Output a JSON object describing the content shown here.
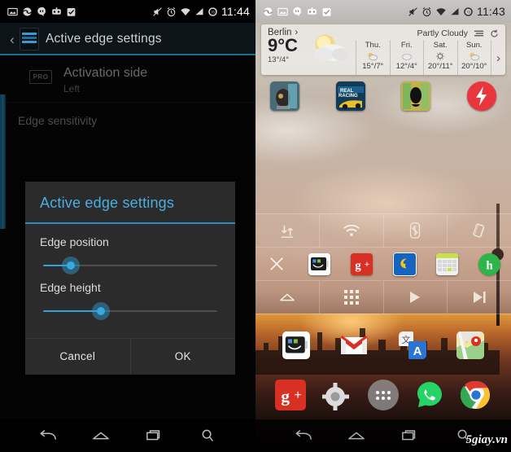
{
  "left_phone": {
    "status_bar": {
      "time": "11:44",
      "left_icons": [
        "screenshot-icon",
        "hangouts-sync-icon",
        "hangouts-icon",
        "app-update-icon",
        "checkbox-app-icon"
      ],
      "right_icons": [
        "mute-icon",
        "alarm-icon",
        "wifi-icon",
        "signal-icon",
        "battery-icon"
      ]
    },
    "action_bar": {
      "back_label": "‹",
      "app_icon": "edge-app-icon",
      "title": "Active edge settings"
    },
    "settings": {
      "pref": {
        "badge": "PRO",
        "title": "Activation side",
        "value": "Left"
      },
      "section_header": "Edge sensitivity"
    },
    "dialog": {
      "title": "Active edge settings",
      "sliders": [
        {
          "label": "Edge position",
          "percent": 17
        },
        {
          "label": "Edge height",
          "percent": 34
        }
      ],
      "cancel_label": "Cancel",
      "ok_label": "OK"
    },
    "nav_bar": {
      "back": "back-icon",
      "home": "home-icon",
      "recents": "recents-icon",
      "search": "search-icon"
    }
  },
  "right_phone": {
    "status_bar": {
      "time": "11:43",
      "left_icons": [
        "hangouts-sync-icon",
        "screenshot-icon",
        "hangouts-icon",
        "app-update-icon",
        "checkbox-app-icon"
      ],
      "right_icons": [
        "mute-icon",
        "alarm-icon",
        "wifi-icon",
        "signal-icon",
        "battery-icon"
      ]
    },
    "weather": {
      "city": "Berlin",
      "city_chevron": "›",
      "temp": "9°C",
      "high_low": "13°/4°",
      "condition": "Partly Cloudy",
      "menu_icon": "list-icon",
      "refresh_icon": "refresh-icon",
      "next_icon": "›",
      "forecast": [
        {
          "day": "Thu.",
          "icon": "partly-cloudy-icon",
          "temps": "15°/7°"
        },
        {
          "day": "Fri.",
          "icon": "cloudy-icon",
          "temps": "12°/4°"
        },
        {
          "day": "Sat.",
          "icon": "sunny-icon",
          "temps": "20°/11°"
        },
        {
          "day": "Sun.",
          "icon": "partly-cloudy-icon",
          "temps": "20°/10°"
        }
      ]
    },
    "top_apps": [
      {
        "name": "shooter-game-icon"
      },
      {
        "name": "real-racing-icon"
      },
      {
        "name": "dungeon-game-icon"
      },
      {
        "name": "boost-icon"
      }
    ],
    "edge_panel": {
      "toggles": [
        {
          "name": "mobile-data-toggle"
        },
        {
          "name": "wifi-toggle"
        },
        {
          "name": "bluetooth-toggle"
        },
        {
          "name": "rotation-toggle"
        }
      ],
      "apps": [
        {
          "name": "close-icon"
        },
        {
          "name": "smiley-tablet-icon"
        },
        {
          "name": "google-plus-icon"
        },
        {
          "name": "swiftkey-icon"
        },
        {
          "name": "calendar-icon"
        },
        {
          "name": "hopper-icon"
        }
      ],
      "controls": [
        {
          "name": "home-icon"
        },
        {
          "name": "app-drawer-icon"
        },
        {
          "name": "play-icon"
        },
        {
          "name": "next-track-icon"
        }
      ]
    },
    "home_apps_row_1": [
      {
        "name": "smiley-tablet-icon"
      },
      {
        "name": "gmail-icon"
      },
      {
        "name": "google-translate-icon"
      },
      {
        "name": "google-maps-icon"
      }
    ],
    "home_apps_row_2": [
      {
        "name": "google-plus-icon"
      },
      {
        "name": "settings-icon"
      },
      {
        "name": "app-drawer-icon"
      },
      {
        "name": "whatsapp-icon"
      },
      {
        "name": "chrome-icon"
      }
    ],
    "nav_bar": {
      "back": "back-icon",
      "home": "home-icon",
      "recents": "recents-icon",
      "search": "search-icon"
    },
    "watermark": "5giay.vn"
  },
  "colors": {
    "accent_blue": "#36a9de",
    "action_bar_underline": "#1b6f96",
    "dialog_bg": "#2b2b2b",
    "status_bar_dark": "#000000"
  }
}
